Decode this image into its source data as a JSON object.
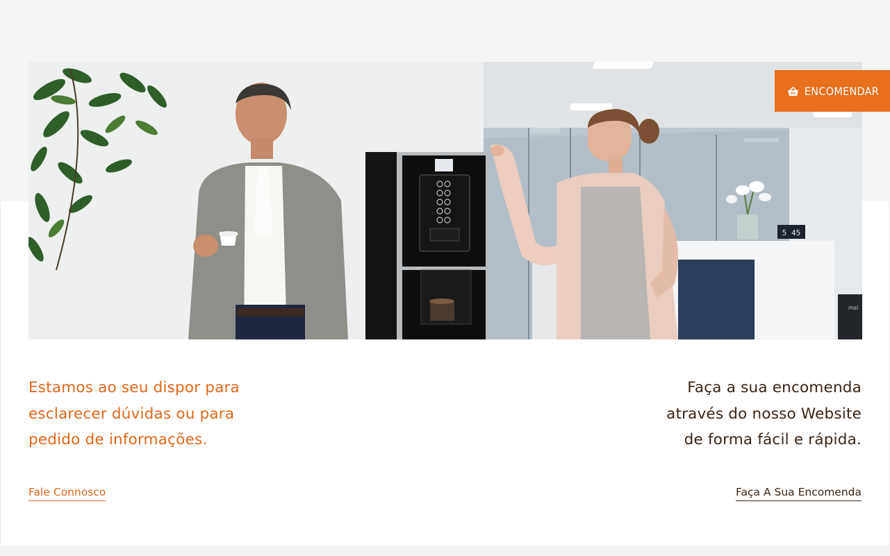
{
  "order_button": {
    "label": "ENCOMENDAR",
    "icon": "basket-icon"
  },
  "hero": {
    "clock_display": "5 45",
    "screen_brand": "msi"
  },
  "left_column": {
    "lines": [
      "Estamos ao seu dispor para",
      "esclarecer dúvidas ou para",
      "pedido de informações."
    ],
    "link_label": "Fale Connosco"
  },
  "right_column": {
    "lines": [
      "Faça a sua encomenda",
      "através do nosso Website",
      "de forma fácil e rápida."
    ],
    "link_label": "Faça A Sua Encomenda"
  },
  "colors": {
    "accent": "#e76f1d",
    "accent_text": "#e0671a",
    "dark_text": "#3a2414",
    "page_top_band": "#f5f5f5"
  }
}
